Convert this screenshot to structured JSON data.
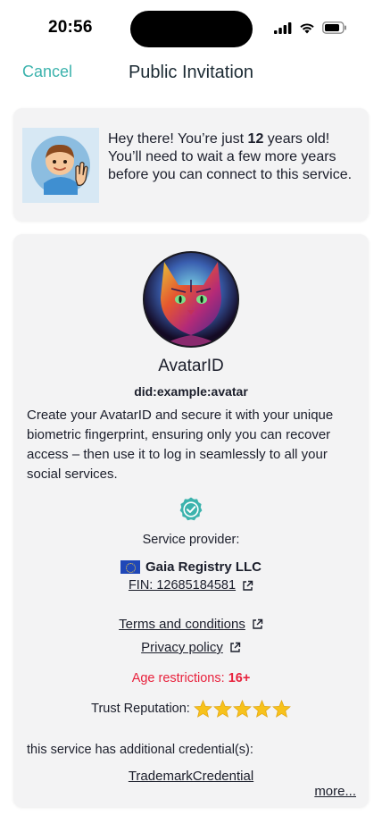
{
  "status_bar": {
    "time": "20:56"
  },
  "header": {
    "cancel_label": "Cancel",
    "title": "Public Invitation"
  },
  "age_warning": {
    "text_before": "Hey there! You’re just ",
    "age": "12",
    "text_after": " years old! You’ll need to wait a few more years before you can connect to this service."
  },
  "service": {
    "name": "AvatarID",
    "did": "did:example:avatar",
    "description": "Create your AvatarID and secure it with your unique biometric fingerprint, ensuring only you can recover access – then use it to log in seamlessly to all your social services.",
    "provider_label": "Service provider:",
    "provider_name": "Gaia Registry LLC",
    "fin": "FIN: 12685184581",
    "terms_label": "Terms and conditions",
    "privacy_label": "Privacy policy",
    "age_label": "Age restrictions: ",
    "age_value": "16+",
    "trust_label": "Trust Reputation:",
    "trust_stars": 5,
    "extra_label": "this service has additional credential(s):",
    "credential": "TrademarkCredential",
    "more_label": "more..."
  },
  "colors": {
    "accent": "#3cb3ad",
    "danger": "#e8223d",
    "star": "#f7c21c"
  }
}
